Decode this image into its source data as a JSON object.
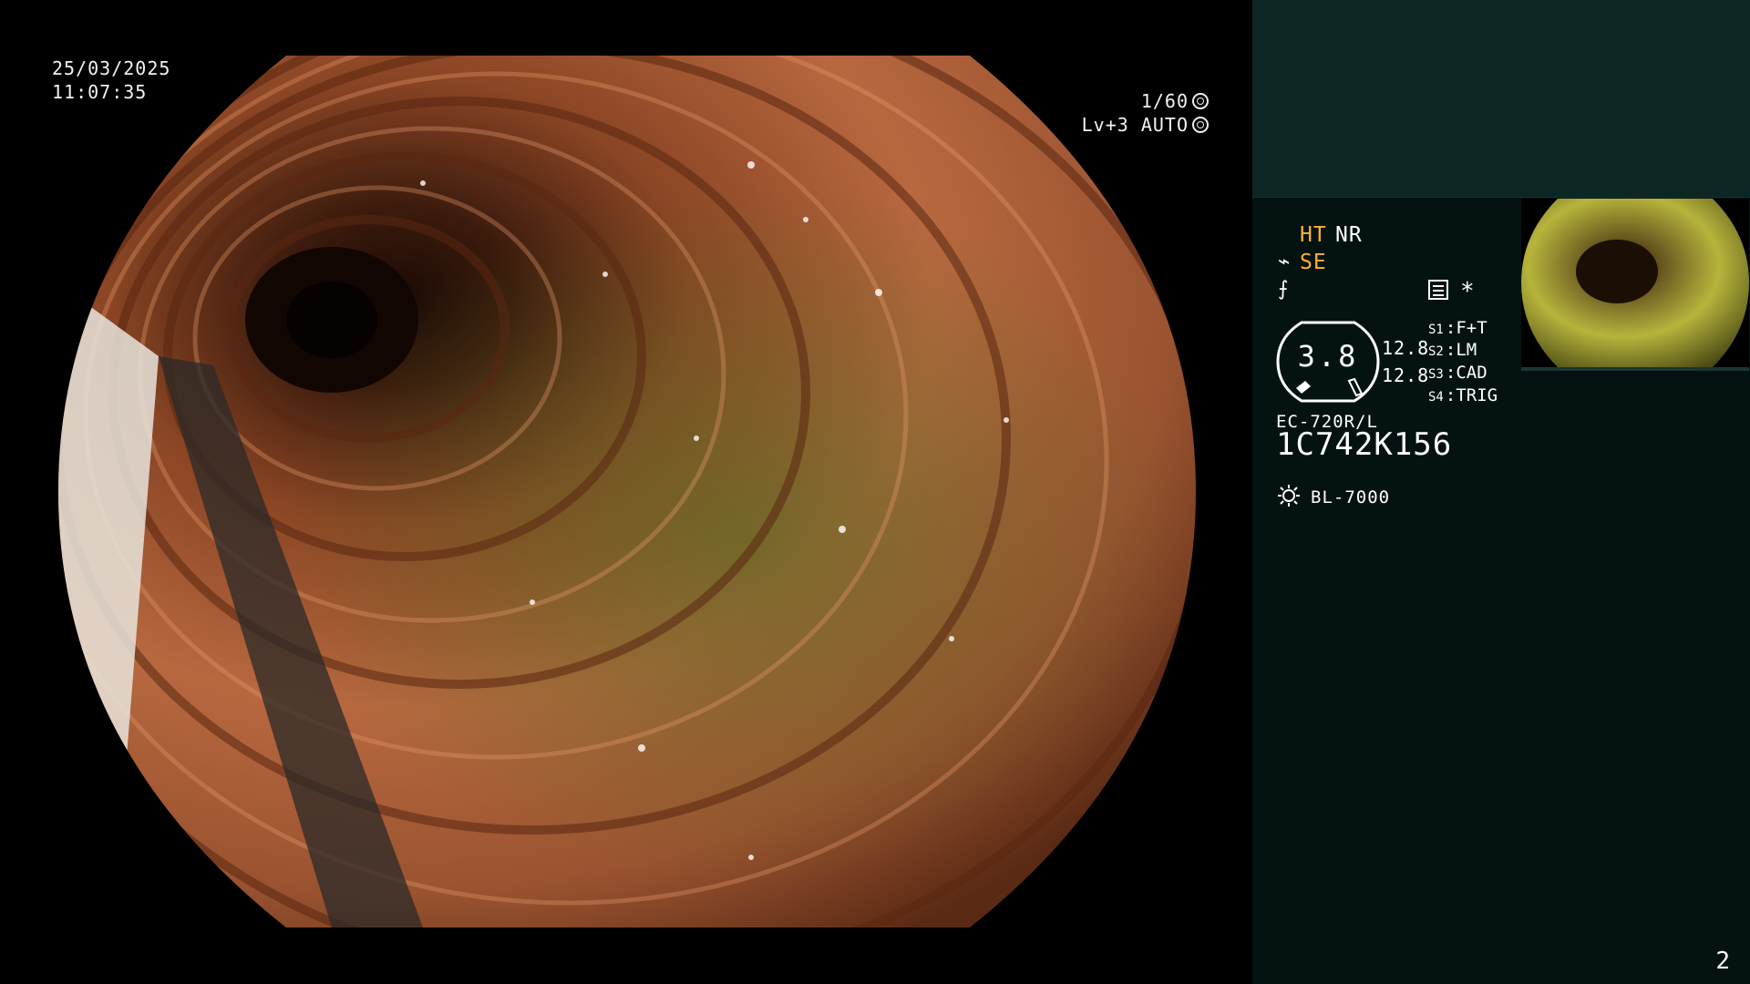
{
  "overlay": {
    "date": "25/03/2025",
    "time": "11:07:35",
    "shutter": "1/60",
    "level_mode": "Lv+3 AUTO"
  },
  "panel": {
    "ht": "HT",
    "nr": "NR",
    "se": "SE",
    "asterisk": "*",
    "gauge_value": "3.8",
    "value_a": "12.8",
    "value_b": "12.8",
    "switches": [
      {
        "key": "S1",
        "value": "F+T"
      },
      {
        "key": "S2",
        "value": "LM"
      },
      {
        "key": "S3",
        "value": "CAD"
      },
      {
        "key": "S4",
        "value": "TRIG"
      }
    ],
    "scope_model": "EC-720R/L",
    "scope_serial": "1C742K156",
    "light_source": "BL-7000",
    "page_number": "2"
  },
  "colors": {
    "accent_orange": "#ffb231",
    "panel_bg": "#041312",
    "panel_top_bg": "#0c2624"
  },
  "icons": [
    "shutter-icon",
    "auto-iris-icon",
    "enhancement-icon",
    "color-mode-icon",
    "menu-icon",
    "light-source-icon"
  ]
}
